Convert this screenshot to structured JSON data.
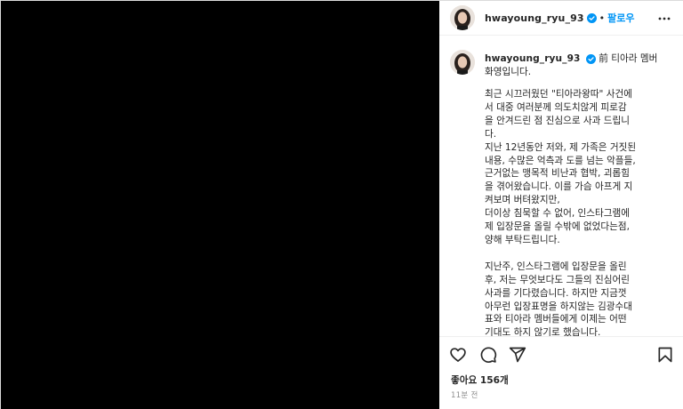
{
  "post": {
    "username": "hwayoung_ryu_93",
    "follow_label": "팔로우",
    "separator": "•"
  },
  "caption": {
    "intro": "前 티아라 멤버\n화영입니다.",
    "body": "최근 시끄러웠던 \"티아라왕따\" 사건에\n서 대중 여러분께 의도치않게 피로감\n을 안겨드린 점 진심으로 사과 드립니\n다.\n지난 12년동안 저와, 제 가족은 거짓된\n내용, 수많은 억측과 도를 넘는 악플들,\n근거없는 맹목적 비난과 협박, 괴롭힘\n을 겪어왔습니다. 이를 가슴 아프게 지\n켜보며 버텨왔지만,\n더이상 침묵할 수 없어, 인스타그램에\n제 입장문을 올릴 수밖에 없었다는점,\n양해 부탁드립니다.\n\n지난주, 인스타그램에 입장문을 올린\n후, 저는 무엇보다도 그들의 진심어린\n사과를 기다렸습니다. 하지만 지금껏\n아무런 입장표명을 하지않는 김광수대\n표와 티아라 멤버들에게 이제는 어떤\n기대도 하지 않기로 했습니다."
  },
  "footer": {
    "likes": "좋아요 156개",
    "time": "11분 전"
  },
  "icons": {
    "verified": "verified-badge-icon",
    "more": "more-options-icon",
    "like": "heart-icon",
    "comment": "comment-icon",
    "share": "share-icon",
    "save": "bookmark-icon"
  },
  "colors": {
    "accent": "#0095f6",
    "verified": "#0095f6",
    "muted": "#8e8e8e",
    "media": "#000000"
  }
}
